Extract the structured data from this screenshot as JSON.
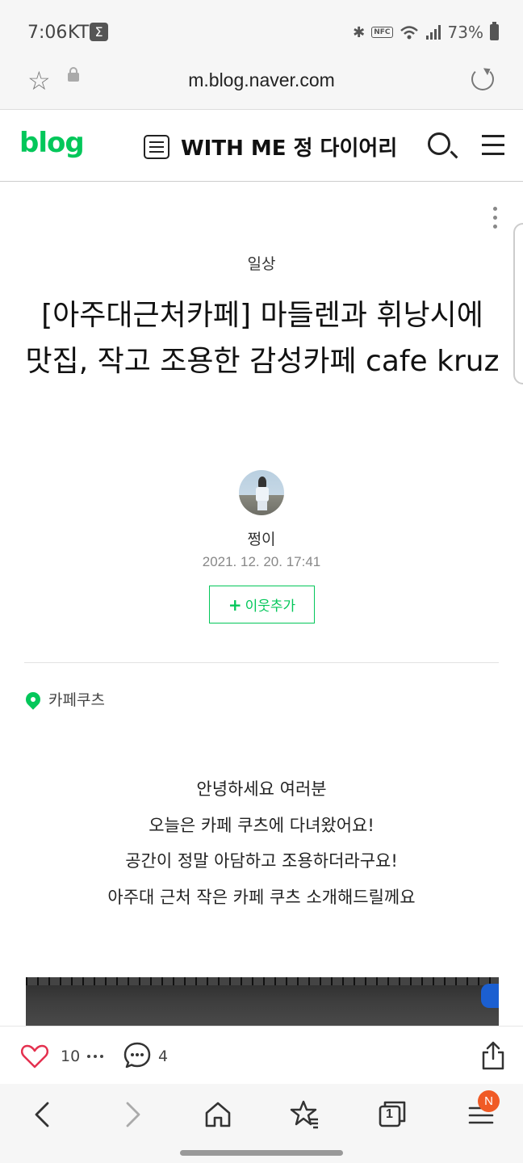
{
  "status_bar": {
    "time": "7:06",
    "carrier": "KT",
    "carrier_icon": "Σ",
    "battery": "73%"
  },
  "url_bar": {
    "url": "m.blog.naver.com"
  },
  "header": {
    "logo": "blog",
    "blog_title": "WITH ME 정 다이어리"
  },
  "post": {
    "category": "일상",
    "title": "[아주대근처카페] 마들렌과 휘낭시에 맛집, 작고 조용한 감성카페 cafe kruz",
    "author": "쩡이",
    "date": "2021. 12. 20. 17:41",
    "follow_label": "이웃추가",
    "follow_plus": "+",
    "place": "카페쿠츠",
    "body_lines": [
      "안녕하세요 여러분",
      "오늘은 카페 쿠츠에 다녀왔어요!",
      "공간이 정말 아담하고 조용하더라구요!",
      "아주대 근처 작은 카페 쿠츠 소개해드릴께요"
    ]
  },
  "actions": {
    "like_count": "10",
    "comment_count": "4"
  },
  "nav": {
    "tabs_count": "1",
    "menu_badge": "N"
  },
  "colors": {
    "brand_green": "#03c75a",
    "like_red": "#e4314f",
    "badge_orange": "#f05a25"
  }
}
